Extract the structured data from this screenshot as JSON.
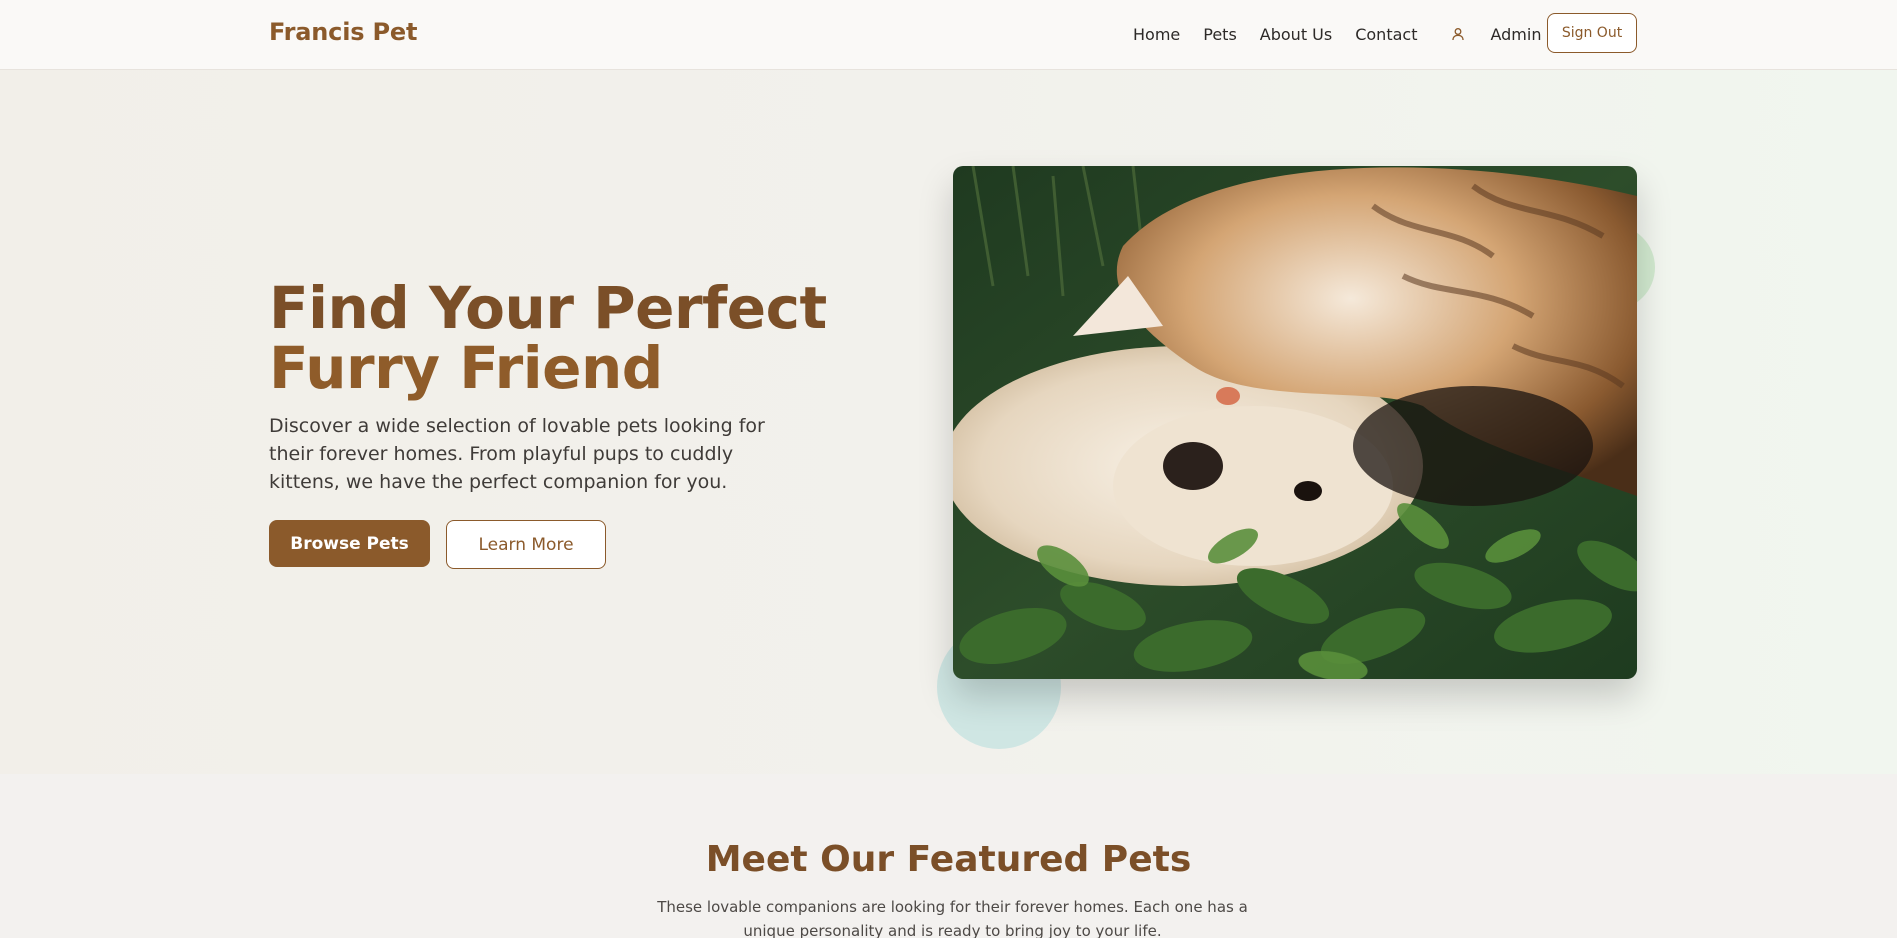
{
  "header": {
    "brand": "Francis Pet",
    "nav": [
      "Home",
      "Pets",
      "About Us",
      "Contact"
    ],
    "user_icon": "user-icon",
    "admin_label": "Admin",
    "signout_label": "Sign Out"
  },
  "hero": {
    "title_part1": "Find Your Perfect ",
    "title_part2": "Furry Friend",
    "description": "Discover a wide selection of lovable pets looking for their forever homes. From playful pups to cuddly kittens, we have the perfect companion for you.",
    "primary_button": "Browse Pets",
    "secondary_button": "Learn More",
    "image_alt": "cat and dog cuddling in grass"
  },
  "featured": {
    "title": "Meet Our Featured Pets",
    "subtitle": "These lovable companions are looking for their forever homes. Each one has a unique personality and is ready to bring joy to your life."
  },
  "colors": {
    "brand": "#8b5a2b",
    "heading": "#7b4f28",
    "background": "#f3f1ee"
  }
}
